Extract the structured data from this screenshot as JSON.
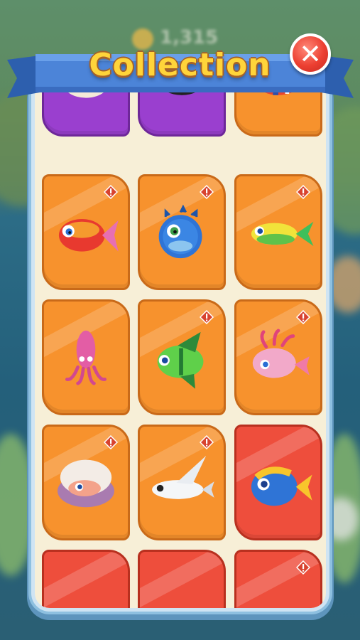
{
  "header": {
    "title": "Collection",
    "close_label": "✕"
  },
  "background": {
    "coins_text": "1,315"
  },
  "cards": [
    {
      "id": "r0c0",
      "color": "purple",
      "alert": false,
      "creature": "pufferfish-white-icon"
    },
    {
      "id": "r0c1",
      "color": "purple",
      "alert": false,
      "creature": "penguin-fish-icon"
    },
    {
      "id": "r0c2",
      "color": "orange",
      "alert": false,
      "creature": "clownfish-icon"
    },
    {
      "id": "r1c0",
      "color": "orange",
      "alert": true,
      "creature": "goldfish-red-icon"
    },
    {
      "id": "r1c1",
      "color": "orange",
      "alert": true,
      "creature": "blue-pufferfish-icon"
    },
    {
      "id": "r1c2",
      "color": "orange",
      "alert": true,
      "creature": "yellow-green-fish-icon"
    },
    {
      "id": "r2c0",
      "color": "orange",
      "alert": false,
      "creature": "pink-squid-icon"
    },
    {
      "id": "r2c1",
      "color": "orange",
      "alert": true,
      "creature": "green-angelfish-icon"
    },
    {
      "id": "r2c2",
      "color": "orange",
      "alert": true,
      "creature": "pink-axolotl-fish-icon"
    },
    {
      "id": "r3c0",
      "color": "orange",
      "alert": true,
      "creature": "oyster-icon"
    },
    {
      "id": "r3c1",
      "color": "orange",
      "alert": true,
      "creature": "white-flying-fish-icon"
    },
    {
      "id": "r3c2",
      "color": "red",
      "alert": false,
      "creature": "blue-tang-fish-icon"
    },
    {
      "id": "r4c0",
      "color": "red",
      "alert": false,
      "creature": "blue-fish-partial-icon"
    },
    {
      "id": "r4c1",
      "color": "red",
      "alert": false,
      "creature": "purple-fish-partial-icon"
    },
    {
      "id": "r4c2",
      "color": "red",
      "alert": true,
      "creature": "yellow-pufferfish-partial-icon"
    }
  ],
  "colors": {
    "orange": "#f7922d",
    "purple": "#9a3fcf",
    "red": "#ee4e3c",
    "title": "#ffd43a",
    "ribbon": "#4c84d8"
  }
}
